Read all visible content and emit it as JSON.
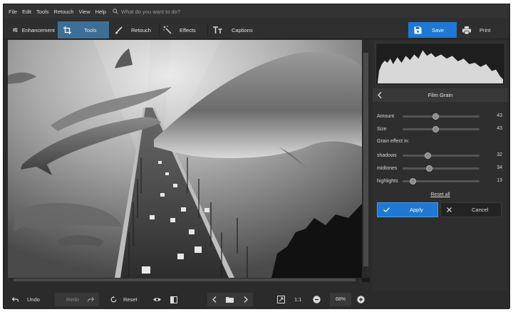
{
  "menu": [
    "File",
    "Edit",
    "Tools",
    "Retouch",
    "View",
    "Help"
  ],
  "search": {
    "placeholder": "What do you want to do?"
  },
  "tabs": [
    {
      "label": "Enhancement",
      "icon": "sliders-icon"
    },
    {
      "label": "Tools",
      "icon": "crop-icon"
    },
    {
      "label": "Retouch",
      "icon": "brush-icon"
    },
    {
      "label": "Effects",
      "icon": "magic-wand-icon"
    },
    {
      "label": "Captions",
      "icon": "text-icon"
    }
  ],
  "active_tab": "Tools",
  "actions": {
    "save": "Save",
    "print": "Print"
  },
  "panel": {
    "title": "Film Grain",
    "sliders": [
      {
        "label": "Amount",
        "value": "43",
        "fraction": 0.43
      },
      {
        "label": "Size",
        "value": "43",
        "fraction": 0.43
      }
    ],
    "grain_heading": "Grain effect in:",
    "grain_sliders": [
      {
        "label": "shadows",
        "value": "32",
        "fraction": 0.32
      },
      {
        "label": "midtones",
        "value": "34",
        "fraction": 0.34
      },
      {
        "label": "highlights",
        "value": "13",
        "fraction": 0.13
      }
    ],
    "reset_all": "Reset all",
    "apply": "Apply",
    "cancel": "Cancel"
  },
  "bottom": {
    "undo": "Undo",
    "redo": "Redo",
    "reset": "Reset",
    "ratio": "1:1",
    "zoom": "68%"
  },
  "colors": {
    "accent": "#1f78d1",
    "active_tab": "#3d6f96",
    "background": "#2b2b2b"
  }
}
